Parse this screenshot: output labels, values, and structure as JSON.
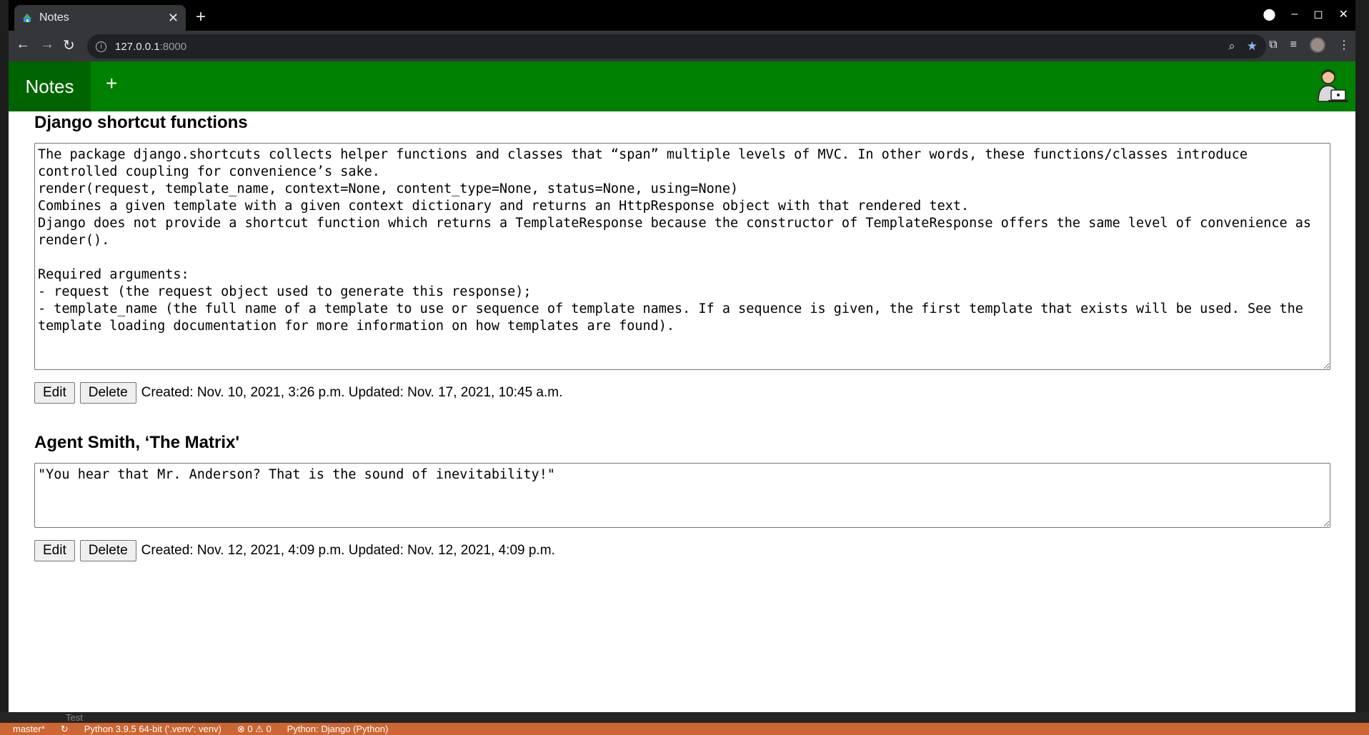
{
  "browser": {
    "tab_title": "Notes",
    "tab_close": "✕",
    "new_tab": "+",
    "url_host": "127.0.0.1",
    "url_port": ":8000",
    "info_icon": "i",
    "zoom_icon": "⌕",
    "bookmark_star": "★",
    "extensions_icon": "⧉",
    "media_icon": "≡",
    "menu_icon": "⋮",
    "window_minimize": "–",
    "window_maximize": "◻",
    "window_close": "✕",
    "back_icon": "←",
    "forward_icon": "→",
    "reload_icon": "↻"
  },
  "navbar": {
    "brand": "Notes",
    "add": "+"
  },
  "notes": [
    {
      "title": "Django shortcut functions",
      "content": "The package django.shortcuts collects helper functions and classes that “span” multiple levels of MVC. In other words, these functions/classes introduce controlled coupling for convenience’s sake.\nrender(request, template_name, context=None, content_type=None, status=None, using=None)\nCombines a given template with a given context dictionary and returns an HttpResponse object with that rendered text.\nDjango does not provide a shortcut function which returns a TemplateResponse because the constructor of TemplateResponse offers the same level of convenience as render().\n\nRequired arguments:\n- request (the request object used to generate this response);\n- template_name (the full name of a template to use or sequence of template names. If a sequence is given, the first template that exists will be used. See the template loading documentation for more information on how templates are found).",
      "edit_label": "Edit",
      "delete_label": "Delete",
      "meta": "Created: Nov. 10, 2021, 3:26 p.m. Updated: Nov. 17, 2021, 10:45 a.m."
    },
    {
      "title": "Agent Smith, ‘The Matrix'",
      "content": "\"You hear that Mr. Anderson? That is the sound of inevitability!\"",
      "edit_label": "Edit",
      "delete_label": "Delete",
      "meta": "Created: Nov. 12, 2021, 4:09 p.m. Updated: Nov. 12, 2021, 4:09 p.m."
    }
  ],
  "vscode": {
    "explorer_item": "Test",
    "branch": "master*",
    "python": "Python 3.9.5 64-bit ('.venv': venv)",
    "problems": "⊗ 0 ⚠ 0",
    "run_config": "Python: Django (Python)"
  },
  "colors": {
    "navbar": "#008000",
    "brand_bg": "#006400",
    "statusbar": "#cc6633"
  }
}
